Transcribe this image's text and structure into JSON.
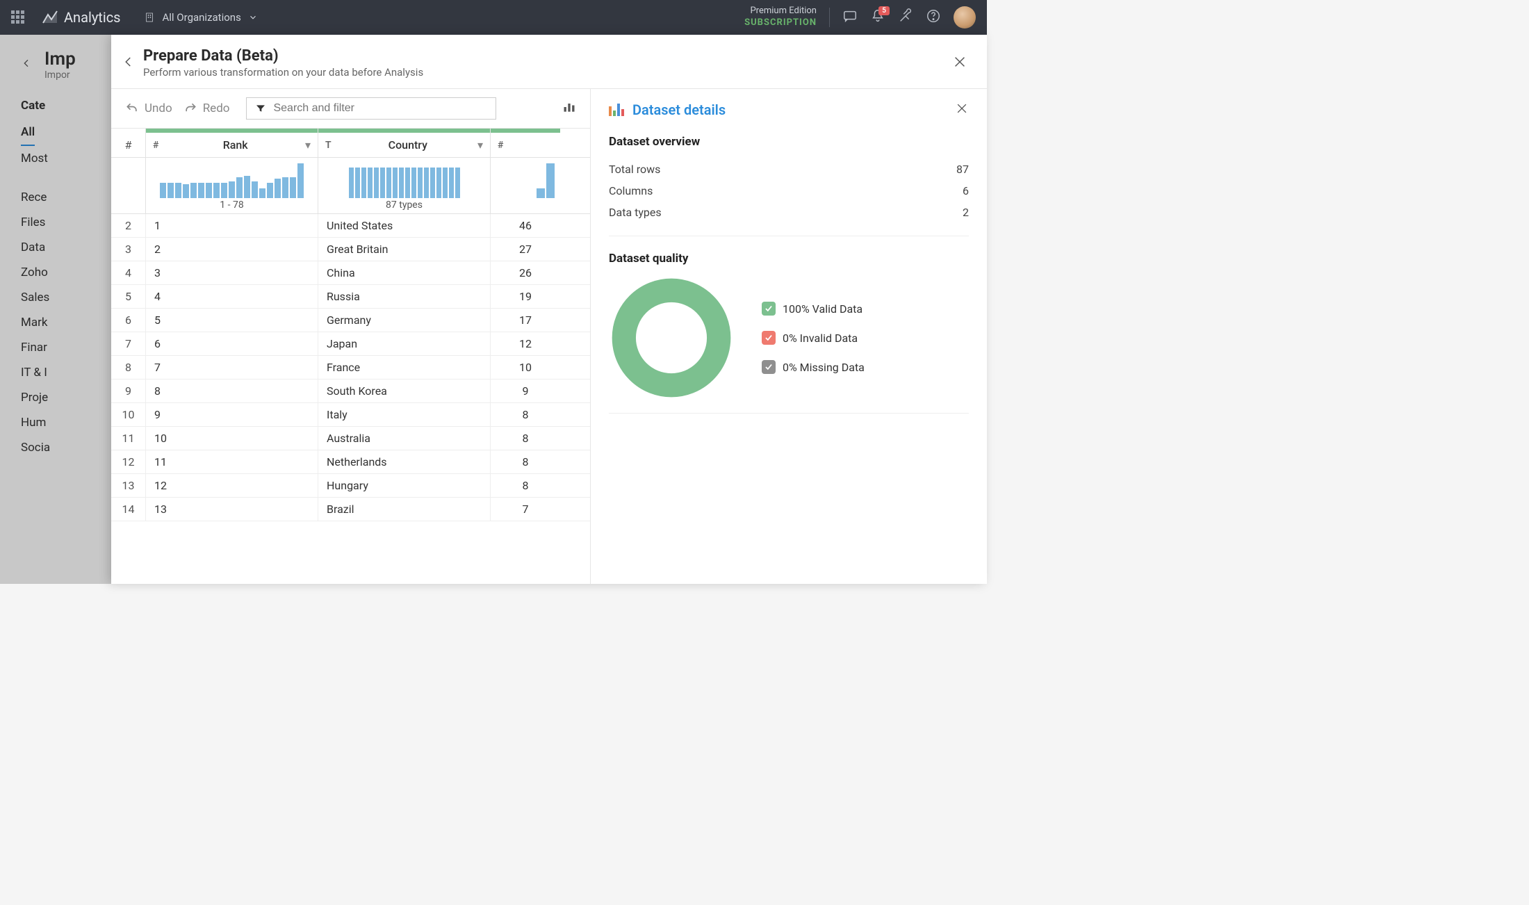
{
  "topbar": {
    "product": "Analytics",
    "org_selector": "All Organizations",
    "edition_line1": "Premium Edition",
    "edition_line2": "SUBSCRIPTION",
    "notification_count": "5"
  },
  "bg": {
    "title_trunc": "Imp",
    "sub_trunc": "Impor",
    "cat_header": "Cate",
    "items": [
      "All",
      "Most",
      "Rece",
      "Files",
      "Data",
      "Zoho",
      "Sales",
      "Mark",
      "Finar",
      "IT & I",
      "Proje",
      "Hum",
      "Socia"
    ]
  },
  "panel": {
    "title": "Prepare Data (Beta)",
    "subtitle": "Perform various transformation on your data before Analysis",
    "undo": "Undo",
    "redo": "Redo",
    "search_placeholder": "Search and filter"
  },
  "columns": {
    "c1": {
      "type": "#",
      "label": "Rank",
      "hist_label": "1 - 78"
    },
    "c2": {
      "type": "T",
      "label": "Country",
      "hist_label": "87 types"
    },
    "c3": {
      "type": "#",
      "label": ""
    }
  },
  "hist": {
    "c1": [
      22,
      22,
      22,
      20,
      22,
      22,
      22,
      22,
      22,
      24,
      30,
      32,
      24,
      14,
      22,
      28,
      30,
      30,
      50
    ],
    "c2": [
      44,
      44,
      44,
      44,
      44,
      44,
      44,
      44,
      44,
      44,
      44,
      44,
      44,
      44,
      44,
      44,
      44,
      44
    ],
    "c3": [
      14,
      50
    ]
  },
  "rows": [
    {
      "n": "2",
      "rank": "1",
      "country": "United States",
      "v": "46"
    },
    {
      "n": "3",
      "rank": "2",
      "country": "Great Britain",
      "v": "27"
    },
    {
      "n": "4",
      "rank": "3",
      "country": "China",
      "v": "26"
    },
    {
      "n": "5",
      "rank": "4",
      "country": "Russia",
      "v": "19"
    },
    {
      "n": "6",
      "rank": "5",
      "country": "Germany",
      "v": "17"
    },
    {
      "n": "7",
      "rank": "6",
      "country": "Japan",
      "v": "12"
    },
    {
      "n": "8",
      "rank": "7",
      "country": "France",
      "v": "10"
    },
    {
      "n": "9",
      "rank": "8",
      "country": "South Korea",
      "v": "9"
    },
    {
      "n": "10",
      "rank": "9",
      "country": "Italy",
      "v": "8"
    },
    {
      "n": "11",
      "rank": "10",
      "country": "Australia",
      "v": "8"
    },
    {
      "n": "12",
      "rank": "11",
      "country": "Netherlands",
      "v": "8"
    },
    {
      "n": "13",
      "rank": "12",
      "country": "Hungary",
      "v": "8"
    },
    {
      "n": "14",
      "rank": "13",
      "country": "Brazil",
      "v": "7"
    }
  ],
  "details": {
    "title": "Dataset details",
    "overview_title": "Dataset overview",
    "rows_label": "Total rows",
    "rows_value": "87",
    "cols_label": "Columns",
    "cols_value": "6",
    "types_label": "Data types",
    "types_value": "2",
    "quality_title": "Dataset quality",
    "legend": [
      {
        "color": "#7cc08f",
        "text": "100% Valid Data"
      },
      {
        "color": "#ef7a6f",
        "text": "0% Invalid Data"
      },
      {
        "color": "#8f8f8f",
        "text": "0% Missing Data"
      }
    ]
  },
  "chart_data": {
    "type": "pie",
    "title": "Dataset quality",
    "series": [
      {
        "name": "Valid Data",
        "value": 100,
        "color": "#7cc08f"
      },
      {
        "name": "Invalid Data",
        "value": 0,
        "color": "#ef7a6f"
      },
      {
        "name": "Missing Data",
        "value": 0,
        "color": "#8f8f8f"
      }
    ]
  }
}
